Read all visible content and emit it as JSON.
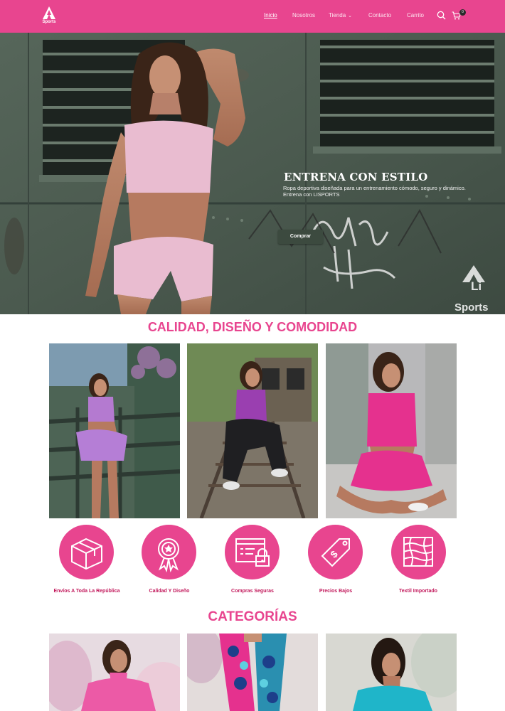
{
  "navbar": {
    "brand": "Sports",
    "links": [
      {
        "label": "Inicio",
        "active": true
      },
      {
        "label": "Nosotros",
        "active": false
      },
      {
        "label": "Tienda",
        "active": false
      },
      {
        "label": "Contacto",
        "active": false
      },
      {
        "label": "Carrito",
        "active": false
      }
    ],
    "cart_count": "0",
    "icons": [
      "search-icon",
      "cart-icon",
      "chevron-down-icon"
    ]
  },
  "hero": {
    "title": "ENTRENA CON ESTILO",
    "subtitle": "Ropa deportiva diseñada para un entrenamiento cómodo, seguro y dinámico. Entrena con LISPORTS",
    "button": "Comprar",
    "watermark_top": "Li",
    "watermark_bottom": "Sports"
  },
  "quality": {
    "title": "CALIDAD, DISEÑO Y COMODIDAD"
  },
  "features": [
    {
      "label": "Envíos A Toda La República",
      "icon": "box-icon"
    },
    {
      "label": "Calidad Y Diseño",
      "icon": "medal-icon"
    },
    {
      "label": "Compras Seguras",
      "icon": "secure-browser-icon"
    },
    {
      "label": "Precios Bajos",
      "icon": "price-tag-icon"
    },
    {
      "label": "Textil Importado",
      "icon": "fabric-icon"
    }
  ],
  "categories": {
    "title": "CATEGORÍAS"
  },
  "colors": {
    "brand_pink": "#e8458f",
    "dark_pink": "#c2185b",
    "hero_button": "#3c4a3f"
  }
}
